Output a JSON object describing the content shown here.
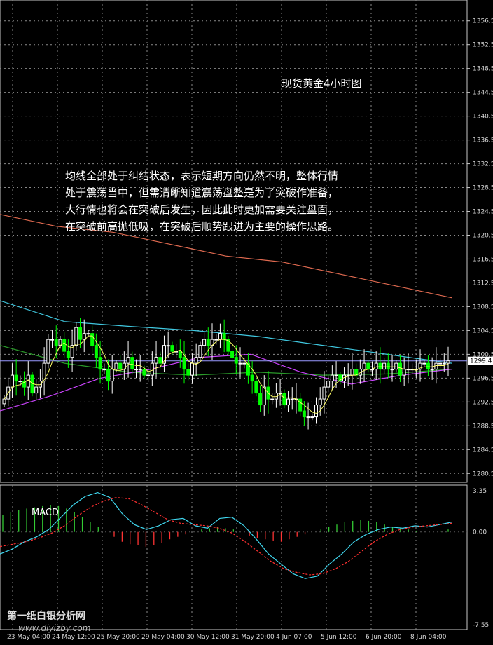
{
  "chart_data": [
    {
      "type": "candlestick",
      "title": "现货黄金4小时图",
      "annotation_lines": [
        "均线全部处于纠结状态，表示短期方向仍然不明，整体行情",
        "处于震荡当中，但需清晰知道震荡盘整是为了突破作准备，",
        "大行情也将会在突破后发生，因此此时更加需要关注盘面，",
        "在突破前高抛低吸，在突破后顺势跟进为主要的操作思路。"
      ],
      "ylim": [
        1279,
        1360
      ],
      "y_ticks": [
        "1356.5",
        "1352.5",
        "1348.5",
        "1344.5",
        "1340.5",
        "1336.5",
        "1332.5",
        "1328.5",
        "1324.5",
        "1320.5",
        "1316.5",
        "1312.5",
        "1308.5",
        "1304.5",
        "1300.5",
        "1296.5",
        "1292.5",
        "1288.5",
        "1284.5",
        "1280.5"
      ],
      "current_price": "1299.4",
      "x_tick_labels": [
        "23 May 04:00",
        "24 May 12:00",
        "25 May 20:00",
        "29 May 04:00",
        "30 May 12:00",
        "31 May 20:00",
        "4 Jun 07:00",
        "5 Jun 12:00",
        "6 Jun 20:00",
        "8 Jun 04:00"
      ],
      "grid": true,
      "colors": {
        "background": "#000000",
        "up_candle": "#ffffff",
        "down_candle": "#00ff00",
        "ma_short": "#ffff66",
        "ma_medium": "#cc44ff",
        "ma_long_cyan": "#40c8e0",
        "ma_long_red": "#e06a50",
        "ma_green": "#2a9a2a",
        "price_line": "#9999ff"
      },
      "closes": [
        1293,
        1295,
        1297,
        1296,
        1296,
        1295,
        1297,
        1294,
        1295,
        1296,
        1299,
        1303,
        1303,
        1302,
        1303,
        1301,
        1300,
        1302,
        1305,
        1303,
        1304,
        1304,
        1302,
        1300,
        1298,
        1298,
        1296,
        1298,
        1299,
        1298,
        1299,
        1300,
        1298,
        1298,
        1298,
        1297,
        1297,
        1299,
        1300,
        1299,
        1302,
        1302,
        1301,
        1301,
        1300,
        1298,
        1297,
        1299,
        1300,
        1302,
        1303,
        1302,
        1303,
        1303,
        1304,
        1303,
        1301,
        1300,
        1299,
        1299,
        1299,
        1297,
        1296,
        1294,
        1292,
        1295,
        1293,
        1293,
        1294,
        1294,
        1292,
        1293,
        1293,
        1293,
        1291,
        1290,
        1290,
        1290,
        1292,
        1293,
        1295,
        1296,
        1297,
        1297,
        1296,
        1297,
        1297,
        1298,
        1297,
        1298,
        1299,
        1298,
        1298,
        1299,
        1298,
        1299,
        1298,
        1298,
        1299,
        1297,
        1298,
        1298,
        1298,
        1298,
        1299,
        1299,
        1298,
        1298,
        1299,
        1299,
        1299,
        1299.4
      ],
      "ma_long_red": [
        1324,
        1322,
        1321,
        1319,
        1317,
        1316,
        1314,
        1312,
        1310
      ],
      "ma_long_cyan": [
        1309.5,
        1306,
        1305.2,
        1304.5,
        1303.5,
        1302,
        1300.5,
        1299
      ],
      "ma_green": [
        1302,
        1299,
        1297.5,
        1297,
        1297.5,
        1297,
        1297.2,
        1298
      ],
      "ma_medium": [
        1291,
        1293.5,
        1296.5,
        1298,
        1300,
        1300.5,
        1297.5,
        1295.5,
        1297,
        1298
      ]
    },
    {
      "type": "macd",
      "label": "MACD",
      "ylim": [
        -7.55,
        3.35
      ],
      "y_ticks": [
        "3.35",
        "0.00",
        "-7.55"
      ],
      "histogram": [
        1.4,
        1.6,
        1.8,
        1.9,
        2.0,
        2.1,
        2.2,
        2.1,
        1.9,
        1.6,
        1.2,
        0.8,
        0.4,
        0.0,
        -0.4,
        -0.8,
        -1.0,
        -1.1,
        -1.2,
        -1.1,
        -0.9,
        -0.6,
        -0.4,
        -0.2,
        0.0,
        0.2,
        0.3,
        0.4,
        0.3,
        0.2,
        0.0,
        -0.3,
        -0.5,
        -0.6,
        -0.7,
        -0.8,
        -0.6,
        -0.4,
        -0.2,
        0.0,
        0.2,
        0.4,
        0.6,
        0.8,
        0.9,
        1.0,
        0.9,
        0.8,
        0.6,
        0.4,
        0.3,
        0.2,
        0.1,
        0.0,
        0.0,
        0.1,
        0.2
      ],
      "macd_line": [
        -1.8,
        -1.4,
        -0.8,
        -0.4,
        0.2,
        1.2,
        2.2,
        2.9,
        3.2,
        2.8,
        1.5,
        0.6,
        0.2,
        0.5,
        1.0,
        1.1,
        0.5,
        0.3,
        1.1,
        1.2,
        0.5,
        -0.6,
        -1.8,
        -2.6,
        -3.4,
        -3.8,
        -3.6,
        -2.6,
        -1.8,
        -0.8,
        -0.2,
        0.2,
        0.4,
        0.3,
        0.5,
        0.4,
        0.6,
        0.8
      ],
      "signal_line": [
        -1.2,
        -1.0,
        -0.8,
        -0.5,
        -0.1,
        0.5,
        1.3,
        2.0,
        2.5,
        2.8,
        2.7,
        2.2,
        1.6,
        1.0,
        0.7,
        0.6,
        0.5,
        0.3,
        -0.1,
        -0.8,
        -1.6,
        -2.4,
        -3.0,
        -3.3,
        -3.5,
        -3.4,
        -3.0,
        -2.4,
        -1.6,
        -0.8,
        -0.2,
        0.2,
        0.4,
        0.5,
        0.6,
        0.7
      ]
    }
  ],
  "watermark": {
    "name": "第一纸白银分析网",
    "url": "www.diyizby.com"
  }
}
